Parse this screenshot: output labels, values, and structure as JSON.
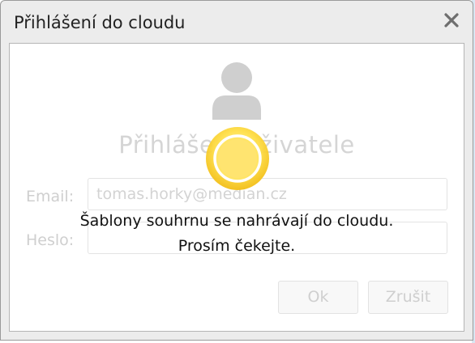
{
  "dialog": {
    "title": "Přihlášení do cloudu",
    "close_icon": "close-x-icon",
    "heading": "Přihlášení uživatele",
    "email_label": "Email:",
    "email_value": "tomas.horky@median.cz",
    "password_label": "Heslo:",
    "password_value": "",
    "ok_label": "Ok",
    "cancel_label": "Zrušit"
  },
  "overlay": {
    "line1": "Šablony souhrnu se nahrávají do cloudu.",
    "line2": "Prosím čekejte.",
    "spinner_icon": "loading-spinner-icon"
  },
  "colors": {
    "dialog_bg": "#ececec",
    "content_bg": "#ffffff",
    "disabled_text": "#cfcfcf",
    "spinner_yellow": "#ffd83a"
  }
}
